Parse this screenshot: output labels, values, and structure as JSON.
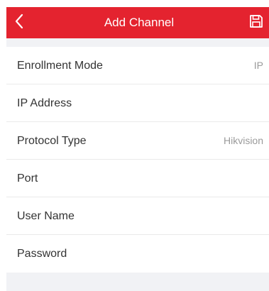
{
  "header": {
    "title": "Add Channel",
    "back_icon": "chevron-left-icon",
    "save_icon": "floppy-disk-icon",
    "color": "#e4232f"
  },
  "form": {
    "rows": [
      {
        "label": "Enrollment Mode",
        "value": "IP"
      },
      {
        "label": "IP Address",
        "value": ""
      },
      {
        "label": "Protocol Type",
        "value": "Hikvision"
      },
      {
        "label": "Port",
        "value": ""
      },
      {
        "label": "User Name",
        "value": ""
      },
      {
        "label": "Password",
        "value": ""
      }
    ]
  }
}
